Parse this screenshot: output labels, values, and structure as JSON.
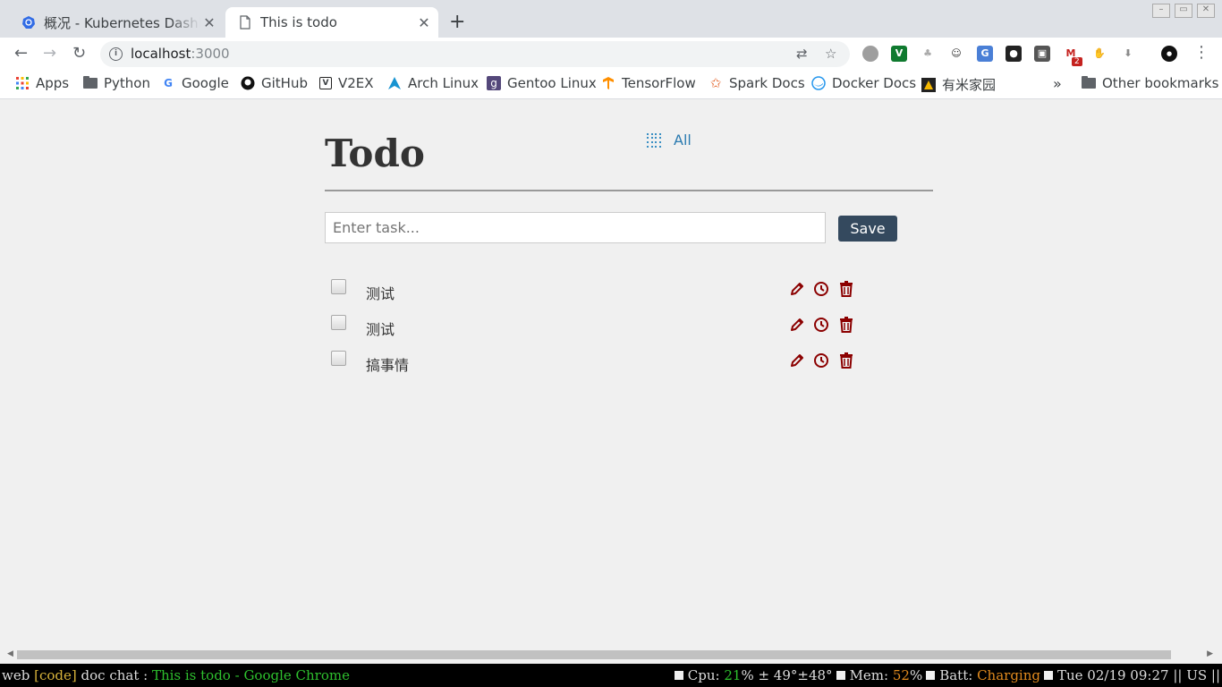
{
  "browser": {
    "tabs": [
      {
        "title": "概况 - Kubernetes Dashboard",
        "active": false,
        "icon": "kubernetes-icon"
      },
      {
        "title": "This is todo",
        "active": true,
        "icon": "page-icon"
      }
    ],
    "address": {
      "host": "localhost",
      "port": ":3000"
    },
    "bookmarks": [
      {
        "label": "Apps",
        "icon": "apps-grid-icon"
      },
      {
        "label": "Python",
        "icon": "folder-icon"
      },
      {
        "label": "Google",
        "icon": "google-icon"
      },
      {
        "label": "GitHub",
        "icon": "github-icon"
      },
      {
        "label": "V2EX",
        "icon": "v2ex-icon"
      },
      {
        "label": "Arch Linux",
        "icon": "arch-linux-icon"
      },
      {
        "label": "Gentoo Linux",
        "icon": "gentoo-icon"
      },
      {
        "label": "TensorFlow",
        "icon": "tensorflow-icon"
      },
      {
        "label": "Spark Docs",
        "icon": "spark-icon"
      },
      {
        "label": "Docker Docs",
        "icon": "docker-icon"
      },
      {
        "label": "有米家园",
        "icon": "youmi-icon"
      }
    ],
    "overflow_label": "»",
    "other_bookmarks": "Other bookmarks",
    "gmail_badge": "2"
  },
  "app": {
    "title": "Todo",
    "filter_label": "All",
    "input_placeholder": "Enter task...",
    "input_value": "",
    "save_label": "Save",
    "tasks": [
      {
        "text": "测试",
        "done": false
      },
      {
        "text": "测试",
        "done": false
      },
      {
        "text": "搞事情",
        "done": false
      }
    ]
  },
  "statusbar": {
    "workspaces": "web",
    "current_workspace": "[code]",
    "other_workspaces": "doc chat :",
    "window_title": "This is todo - Google Chrome",
    "cpu_label": "Cpu:",
    "cpu_value": "21",
    "temps": "% ± 49°±48°",
    "mem_label": "Mem:",
    "mem_value": "52",
    "mem_unit": "%",
    "batt_label": "Batt:",
    "batt_value": "Charging",
    "datetime": "Tue 02/19 09:27",
    "layout": "|| US ||"
  },
  "colors": {
    "action_icon": "#8b0000",
    "save_button": "#34495e",
    "filter_link": "#2a7ab0"
  }
}
